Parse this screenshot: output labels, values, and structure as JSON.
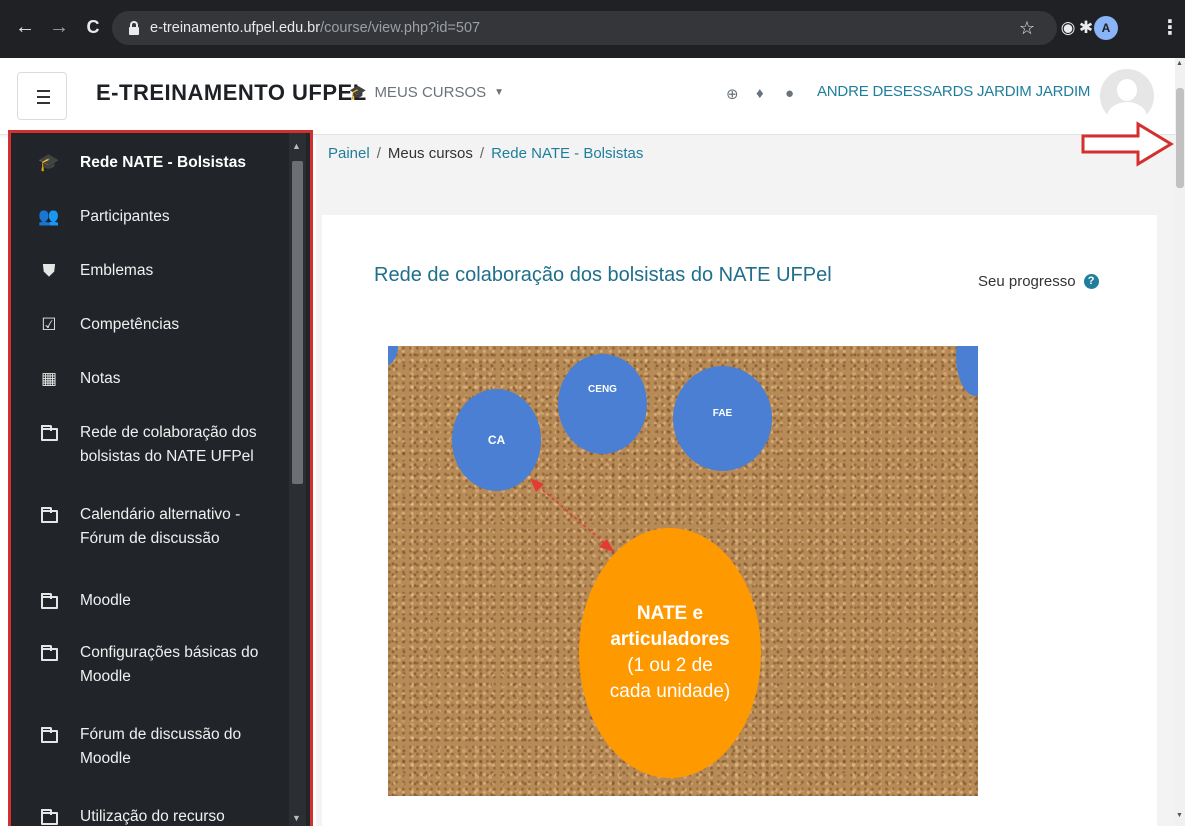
{
  "browser": {
    "back": "←",
    "forward": "→",
    "reload": "C",
    "url_host": "e-treinamento.ufpel.edu.br",
    "url_path": "/course/view.php?id=507",
    "profile_initial": "A"
  },
  "navbar": {
    "site_name": "E-TREINAMENTO UFPEL",
    "my_courses": "MEUS CURSOS",
    "user_name": "ANDRE DESESSARDS JARDIM JARDIM"
  },
  "sidebar": {
    "items": [
      {
        "label": "Rede NATE - Bolsistas",
        "icon": "graduation-cap-icon"
      },
      {
        "label": "Participantes",
        "icon": "users-icon"
      },
      {
        "label": "Emblemas",
        "icon": "shield-icon"
      },
      {
        "label": "Competências",
        "icon": "checkbox-icon"
      },
      {
        "label": "Notas",
        "icon": "table-icon"
      },
      {
        "label": "Rede de colaboração dos bolsistas do NATE UFPel",
        "icon": "folder-icon"
      },
      {
        "label": "Calendário alternativo - Fórum de discussão",
        "icon": "folder-icon"
      },
      {
        "label": "Moodle",
        "icon": "folder-icon"
      },
      {
        "label": "Configurações básicas do Moodle",
        "icon": "folder-icon"
      },
      {
        "label": "Fórum de discussão do Moodle",
        "icon": "folder-icon"
      },
      {
        "label": "Utilização do recurso",
        "icon": "folder-icon"
      }
    ]
  },
  "breadcrumb": {
    "items": [
      "Painel",
      "Meus cursos",
      "Rede NATE - Bolsistas"
    ],
    "separator": "/"
  },
  "content": {
    "section_title": "Rede de colaboração dos bolsistas do NATE UFPel",
    "progress_label": "Seu progresso",
    "help": "?"
  },
  "diagram": {
    "bubbles": {
      "ca": "CA",
      "ceng": "CENG",
      "fae": "FAE"
    },
    "center": {
      "line1": "NATE e",
      "line2": "articuladores",
      "line3": "(1 ou 2 de",
      "line4": "cada unidade)"
    }
  },
  "colors": {
    "accent": "#1f7e9a",
    "sidebar_bg": "#212529",
    "highlight_border": "#d32f2f",
    "bubble_blue": "#4a7fd3",
    "bubble_orange": "#ff9900"
  }
}
